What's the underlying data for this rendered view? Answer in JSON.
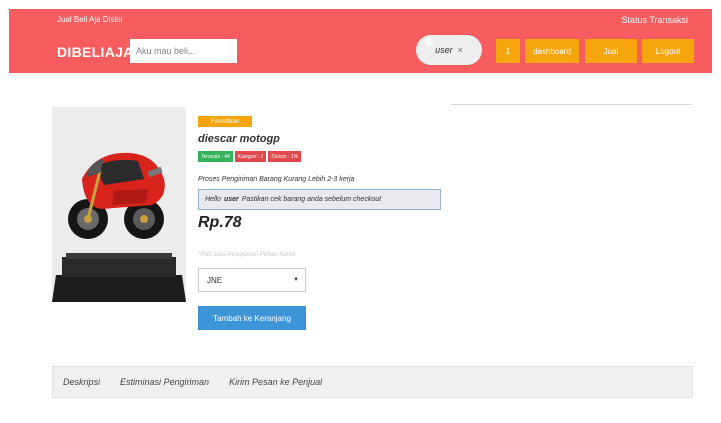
{
  "header": {
    "tagline": "Jual Beli Aja Disini",
    "status_link": "Status Transaksi",
    "brand": "DIBELIAJA",
    "search_placeholder": "Aku mau beli...",
    "user_label": "user",
    "close_glyph": "×",
    "cart_count": "1",
    "dashboard_label": "dashboard",
    "jual_label": "Jual",
    "logout_label": "Logout",
    "colors": {
      "bar": "#f75c5e",
      "button": "#f7a50d"
    }
  },
  "product": {
    "badge": "Favoritkan",
    "name": "diescar motogp",
    "chips": [
      {
        "text": "Tersedia : 44",
        "color": "#34b35a"
      },
      {
        "text": "Kategori : 1",
        "color": "#e0484b"
      },
      {
        "text": "Diskon : 1%",
        "color": "#e0484b"
      }
    ],
    "shipping_note": "Proses Pengiriman Barang Kurang Lebih 2-3 kerja",
    "alert_prefix": "Hello",
    "alert_user": "user",
    "alert_text": "Pastikan cek barang anda sebelum checkout",
    "price": "Rp.78",
    "courier_hint": "*Pilih Jasa Pengiriman Pilihan Kamu",
    "courier_selected": "JNE",
    "add_to_cart": "Tambah ke Keranjang",
    "image_icon": "motorcycle-model-image"
  },
  "tabs": [
    {
      "label": "Deskripsi"
    },
    {
      "label": "Estiminasi Pengiriman"
    },
    {
      "label": "Kirim Pesan ke Penjual"
    }
  ]
}
